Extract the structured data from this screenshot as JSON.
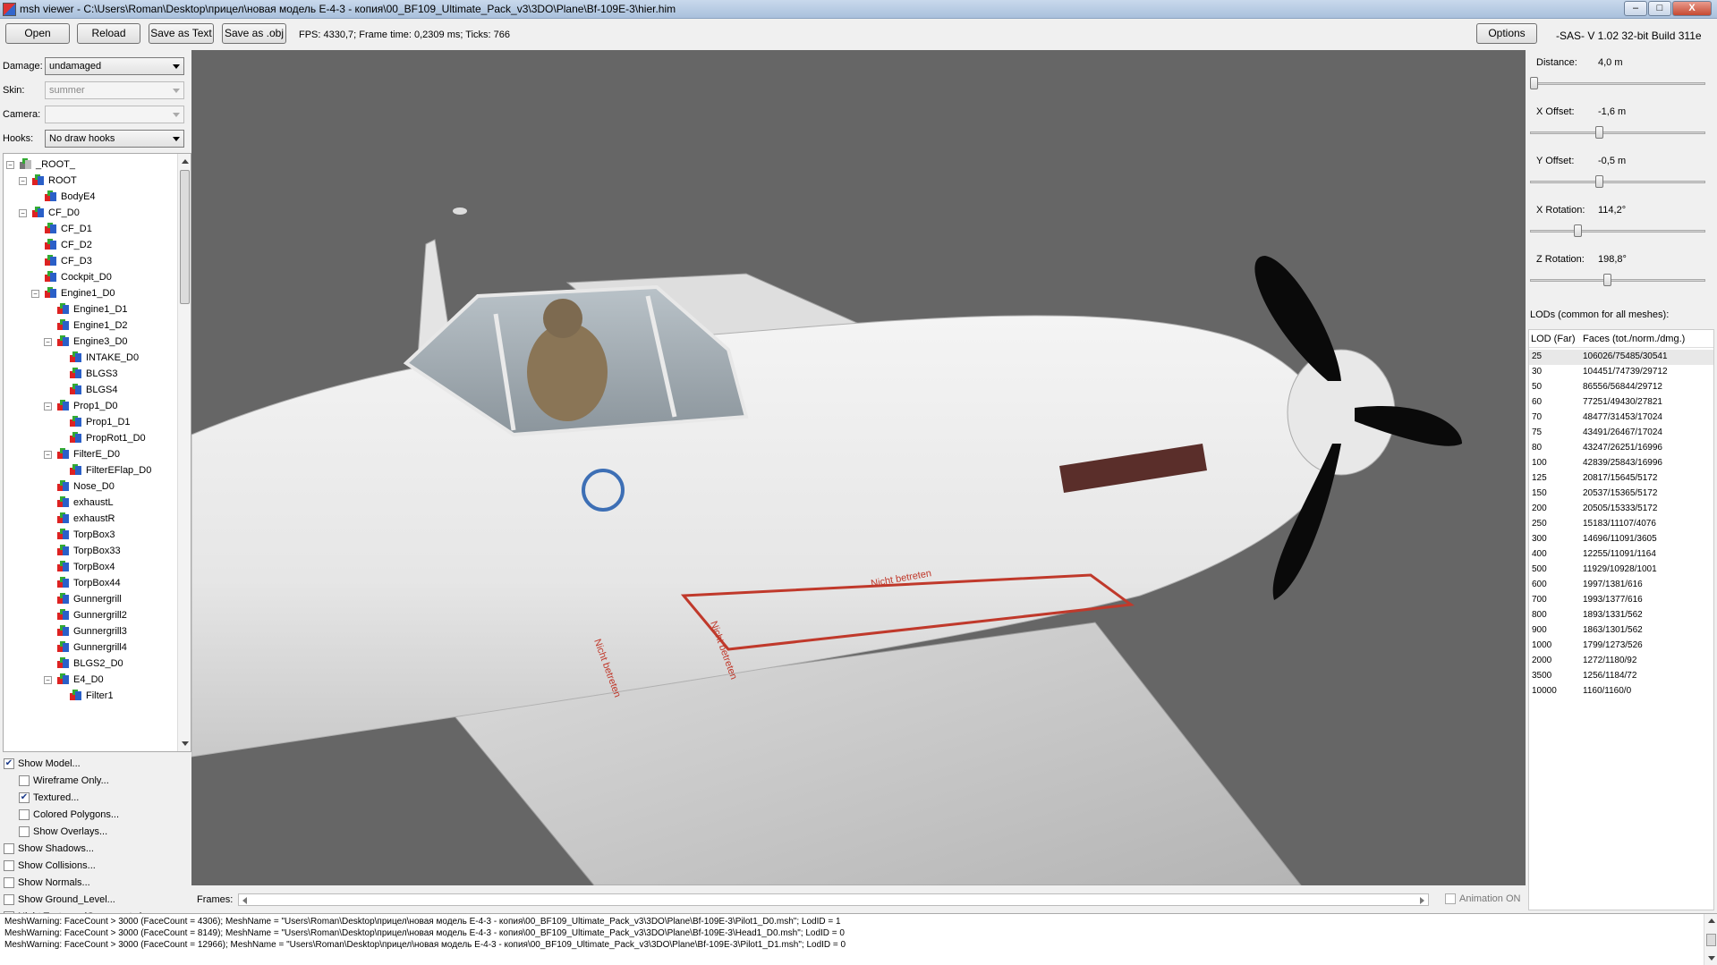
{
  "window": {
    "title": "msh viewer - C:\\Users\\Roman\\Desktop\\прицел\\новая модель E-4-3 - копия\\00_BF109_Ultimate_Pack_v3\\3DO\\Plane\\Bf-109E-3\\hier.him",
    "minimize": "–",
    "maximize": "□",
    "close": "X"
  },
  "toolbar": {
    "open": "Open",
    "reload": "Reload",
    "save_text": "Save as Text",
    "save_obj": "Save as .obj",
    "stats": "FPS: 4330,7; Frame time: 0,2309 ms; Ticks: 766",
    "options": "Options",
    "build": "-SAS- V 1.02  32-bit  Build 311e"
  },
  "left": {
    "damage_label": "Damage:",
    "damage_value": "undamaged",
    "skin_label": "Skin:",
    "skin_value": "summer",
    "camera_label": "Camera:",
    "camera_value": "",
    "hooks_label": "Hooks:",
    "hooks_value": "No draw hooks"
  },
  "tree": [
    {
      "label": "_ROOT_",
      "level": 0,
      "exp": "−",
      "root": true
    },
    {
      "label": "ROOT",
      "level": 1,
      "exp": "−"
    },
    {
      "label": "BodyE4",
      "level": 2,
      "exp": ""
    },
    {
      "label": "CF_D0",
      "level": 1,
      "exp": "−"
    },
    {
      "label": "CF_D1",
      "level": 2,
      "exp": ""
    },
    {
      "label": "CF_D2",
      "level": 2,
      "exp": ""
    },
    {
      "label": "CF_D3",
      "level": 2,
      "exp": ""
    },
    {
      "label": "Cockpit_D0",
      "level": 2,
      "exp": ""
    },
    {
      "label": "Engine1_D0",
      "level": 2,
      "exp": "−"
    },
    {
      "label": "Engine1_D1",
      "level": 3,
      "exp": ""
    },
    {
      "label": "Engine1_D2",
      "level": 3,
      "exp": ""
    },
    {
      "label": "Engine3_D0",
      "level": 3,
      "exp": "−"
    },
    {
      "label": "INTAKE_D0",
      "level": 4,
      "exp": ""
    },
    {
      "label": "BLGS3",
      "level": 4,
      "exp": ""
    },
    {
      "label": "BLGS4",
      "level": 4,
      "exp": ""
    },
    {
      "label": "Prop1_D0",
      "level": 3,
      "exp": "−"
    },
    {
      "label": "Prop1_D1",
      "level": 4,
      "exp": ""
    },
    {
      "label": "PropRot1_D0",
      "level": 4,
      "exp": ""
    },
    {
      "label": "FilterE_D0",
      "level": 3,
      "exp": "−"
    },
    {
      "label": "FilterEFlap_D0",
      "level": 4,
      "exp": ""
    },
    {
      "label": "Nose_D0",
      "level": 3,
      "exp": ""
    },
    {
      "label": "exhaustL",
      "level": 3,
      "exp": ""
    },
    {
      "label": "exhaustR",
      "level": 3,
      "exp": ""
    },
    {
      "label": "TorpBox3",
      "level": 3,
      "exp": ""
    },
    {
      "label": "TorpBox33",
      "level": 3,
      "exp": ""
    },
    {
      "label": "TorpBox4",
      "level": 3,
      "exp": ""
    },
    {
      "label": "TorpBox44",
      "level": 3,
      "exp": ""
    },
    {
      "label": "Gunnergrill",
      "level": 3,
      "exp": ""
    },
    {
      "label": "Gunnergrill2",
      "level": 3,
      "exp": ""
    },
    {
      "label": "Gunnergrill3",
      "level": 3,
      "exp": ""
    },
    {
      "label": "Gunnergrill4",
      "level": 3,
      "exp": ""
    },
    {
      "label": "BLGS2_D0",
      "level": 3,
      "exp": ""
    },
    {
      "label": "E4_D0",
      "level": 3,
      "exp": "−"
    },
    {
      "label": "Filter1",
      "level": 4,
      "exp": ""
    }
  ],
  "options": [
    {
      "label": "Show Model...",
      "checked": true,
      "indent": 0
    },
    {
      "label": "Wireframe Only...",
      "checked": false,
      "indent": 1
    },
    {
      "label": "Textured...",
      "checked": true,
      "indent": 1
    },
    {
      "label": "Colored Polygons...",
      "checked": false,
      "indent": 1
    },
    {
      "label": "Show Overlays...",
      "checked": false,
      "indent": 1
    },
    {
      "label": "Show Shadows...",
      "checked": false,
      "indent": 0
    },
    {
      "label": "Show Collisions...",
      "checked": false,
      "indent": 0
    },
    {
      "label": "Show Normals...",
      "checked": false,
      "indent": 0
    },
    {
      "label": "Show Ground_Level...",
      "checked": false,
      "indent": 0
    },
    {
      "label": "Night Textures (Gauges etc.)...",
      "checked": false,
      "indent": 0
    }
  ],
  "right": {
    "params": [
      {
        "label": "Distance:",
        "value": "4,0 m",
        "level": 0.0
      },
      {
        "label": "X Offset:",
        "value": "-1,6 m",
        "level": 0.39
      },
      {
        "label": "Y Offset:",
        "value": "-0,5 m",
        "level": 0.39
      },
      {
        "label": "X Rotation:",
        "value": "114,2°",
        "level": 0.26
      },
      {
        "label": "Z Rotation:",
        "value": "198,8°",
        "level": 0.44
      }
    ],
    "lods_title": "LODs (common for all meshes):",
    "lod_col1": "LOD (Far)",
    "lod_col2": "Faces (tot./norm./dmg.)",
    "lods": [
      [
        "25",
        "106026/75485/30541"
      ],
      [
        "30",
        "104451/74739/29712"
      ],
      [
        "50",
        "86556/56844/29712"
      ],
      [
        "60",
        "77251/49430/27821"
      ],
      [
        "70",
        "48477/31453/17024"
      ],
      [
        "75",
        "43491/26467/17024"
      ],
      [
        "80",
        "43247/26251/16996"
      ],
      [
        "100",
        "42839/25843/16996"
      ],
      [
        "125",
        "20817/15645/5172"
      ],
      [
        "150",
        "20537/15365/5172"
      ],
      [
        "200",
        "20505/15333/5172"
      ],
      [
        "250",
        "15183/11107/4076"
      ],
      [
        "300",
        "14696/11091/3605"
      ],
      [
        "400",
        "12255/11091/1164"
      ],
      [
        "500",
        "11929/10928/1001"
      ],
      [
        "600",
        "1997/1381/616"
      ],
      [
        "700",
        "1993/1377/616"
      ],
      [
        "800",
        "1893/1331/562"
      ],
      [
        "900",
        "1863/1301/562"
      ],
      [
        "1000",
        "1799/1273/526"
      ],
      [
        "2000",
        "1272/1180/92"
      ],
      [
        "3500",
        "1256/1184/72"
      ],
      [
        "10000",
        "1160/1160/0"
      ]
    ]
  },
  "viewport": {
    "decal_1": "Nicht betreten",
    "decal_2": "Nicht betreten",
    "decal_3": "Nicht betreten",
    "colors": {
      "background": "#666666",
      "fuselage": "#ececec",
      "propeller": "#0a0a0a",
      "warning": "#c0392b"
    }
  },
  "frames": {
    "label": "Frames:",
    "animation": "Animation ON"
  },
  "log": [
    "MeshWarning: FaceCount > 3000 (FaceCount = 4306); MeshName = \"Users\\Roman\\Desktop\\прицел\\новая модель E-4-3 - копия\\00_BF109_Ultimate_Pack_v3\\3DO\\Plane\\Bf-109E-3\\Pilot1_D0.msh\"; LodID = 1",
    "MeshWarning: FaceCount > 3000 (FaceCount = 8149); MeshName = \"Users\\Roman\\Desktop\\прицел\\новая модель E-4-3 - копия\\00_BF109_Ultimate_Pack_v3\\3DO\\Plane\\Bf-109E-3\\Head1_D0.msh\"; LodID = 0",
    "MeshWarning: FaceCount > 3000 (FaceCount = 12966); MeshName = \"Users\\Roman\\Desktop\\прицел\\новая модель E-4-3 - копия\\00_BF109_Ultimate_Pack_v3\\3DO\\Plane\\Bf-109E-3\\Pilot1_D1.msh\"; LodID = 0"
  ]
}
